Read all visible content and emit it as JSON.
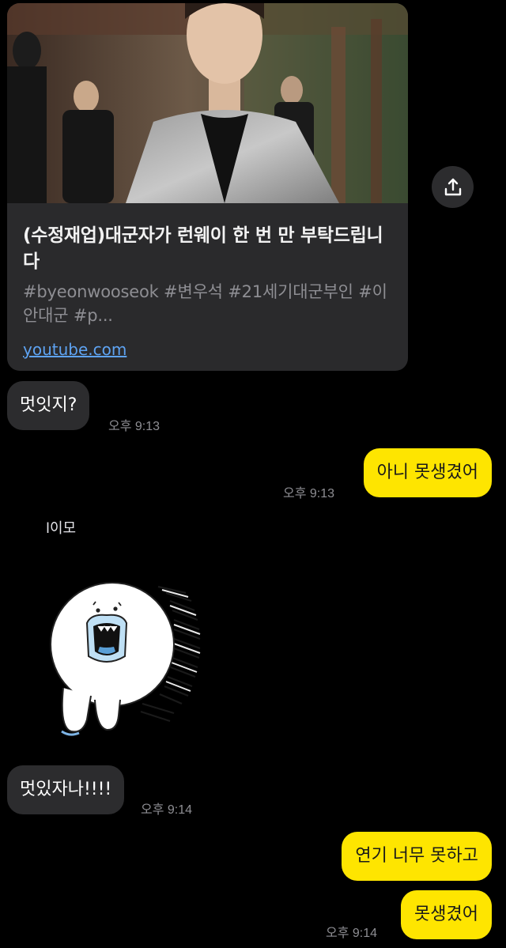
{
  "link_preview": {
    "title": "(수정재업)대군자가 런웨이 한 번 만 부탁드립니다",
    "description": "#byeonwooseok #변우석 #21세기대군부인 #이안대군 #p...",
    "domain": "youtube.com"
  },
  "icons": {
    "share": "share-upload-icon"
  },
  "messages": [
    {
      "side": "in",
      "text": "멋잇지?",
      "time": "오후 9:13"
    },
    {
      "side": "out",
      "text": "아니 못생겼어",
      "time": "오후 9:13"
    },
    {
      "side": "in",
      "sender": "l이모",
      "sticker": "shouting-white-ball-character"
    },
    {
      "side": "in",
      "text": "멋있자나!!!!",
      "time": "오후 9:14"
    },
    {
      "side": "out",
      "text": "연기 너무 못하고"
    },
    {
      "side": "out",
      "text": "못생겼어",
      "time": "오후 9:14"
    }
  ],
  "colors": {
    "background": "#000000",
    "incoming_bubble": "#2c2c2e",
    "outgoing_bubble": "#fee500",
    "link": "#5ea3f2"
  }
}
